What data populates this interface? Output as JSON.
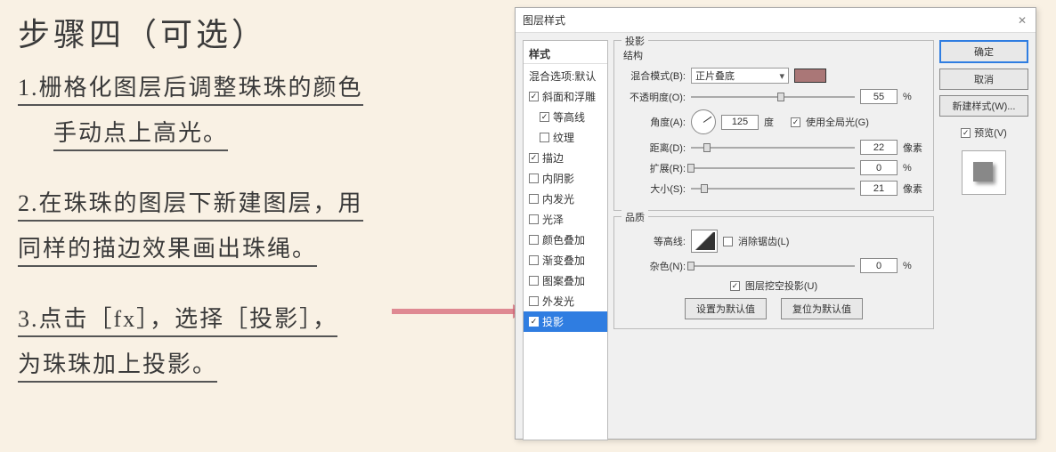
{
  "notes": {
    "title": "步骤四（可选）",
    "p1a": "1.栅格化图层后调整珠珠的颜色",
    "p1b": "手动点上高光。",
    "p2a": "2.在珠珠的图层下新建图层，用",
    "p2b": "同样的描边效果画出珠绳。",
    "p3a": "3.点击［fx］，选择［投影］，",
    "p3b": "为珠珠加上投影。"
  },
  "dialog": {
    "title": "图层样式",
    "close": "✕",
    "styles_header": "样式",
    "blend_defaults": "混合选项:默认",
    "list": [
      {
        "label": "斜面和浮雕",
        "checked": true,
        "sub": false
      },
      {
        "label": "等高线",
        "checked": true,
        "sub": true
      },
      {
        "label": "纹理",
        "checked": false,
        "sub": true
      },
      {
        "label": "描边",
        "checked": true,
        "sub": false
      },
      {
        "label": "内阴影",
        "checked": false,
        "sub": false
      },
      {
        "label": "内发光",
        "checked": false,
        "sub": false
      },
      {
        "label": "光泽",
        "checked": false,
        "sub": false
      },
      {
        "label": "颜色叠加",
        "checked": false,
        "sub": false
      },
      {
        "label": "渐变叠加",
        "checked": false,
        "sub": false
      },
      {
        "label": "图案叠加",
        "checked": false,
        "sub": false
      },
      {
        "label": "外发光",
        "checked": false,
        "sub": false
      },
      {
        "label": "投影",
        "checked": true,
        "sub": false,
        "selected": true
      }
    ],
    "group1": {
      "legend": "投影",
      "sub": "结构",
      "blend_label": "混合模式(B):",
      "blend_value": "正片叠底",
      "opacity_label": "不透明度(O):",
      "opacity_value": "55",
      "opacity_unit": "%",
      "angle_label": "角度(A):",
      "angle_value": "125",
      "angle_unit": "度",
      "global_light": "使用全局光(G)",
      "distance_label": "距离(D):",
      "distance_value": "22",
      "distance_unit": "像素",
      "spread_label": "扩展(R):",
      "spread_value": "0",
      "spread_unit": "%",
      "size_label": "大小(S):",
      "size_value": "21",
      "size_unit": "像素"
    },
    "group2": {
      "legend": "品质",
      "contour_label": "等高线:",
      "antialias": "消除锯齿(L)",
      "noise_label": "杂色(N):",
      "noise_value": "0",
      "noise_unit": "%",
      "knockout": "图层挖空投影(U)"
    },
    "buttons": {
      "make_default": "设置为默认值",
      "reset_default": "复位为默认值",
      "ok": "确定",
      "cancel": "取消",
      "new_style": "新建样式(W)...",
      "preview": "预览(V)"
    }
  }
}
